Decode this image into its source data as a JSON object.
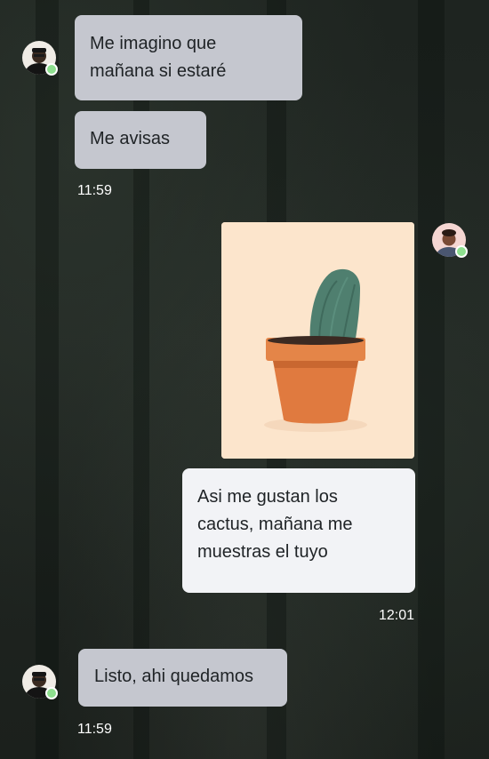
{
  "messages": [
    {
      "direction": "incoming",
      "lines": [
        "Me imagino que",
        "mañana si estaré"
      ]
    },
    {
      "direction": "incoming",
      "lines": [
        "Me avisas"
      ]
    },
    {
      "direction": "incoming",
      "time": "11:59"
    },
    {
      "direction": "outgoing",
      "attachment": "cactus-photo"
    },
    {
      "direction": "outgoing",
      "lines": [
        "Asi me gustan los",
        "cactus, mañana me",
        "muestras el tuyo"
      ]
    },
    {
      "direction": "outgoing",
      "time": "12:01"
    },
    {
      "direction": "incoming",
      "lines": [
        "Listo, ahi quedamos"
      ]
    },
    {
      "direction": "incoming",
      "time": "11:59"
    }
  ],
  "colors": {
    "incoming_bubble": "#c5c7cf",
    "outgoing_bubble": "#f2f3f6",
    "online_status": "#8ee08f",
    "photo_background": "#fce5cc",
    "pot": "#e07a3f",
    "cactus": "#4f7f6f"
  },
  "icons": [
    "online-status-icon"
  ]
}
